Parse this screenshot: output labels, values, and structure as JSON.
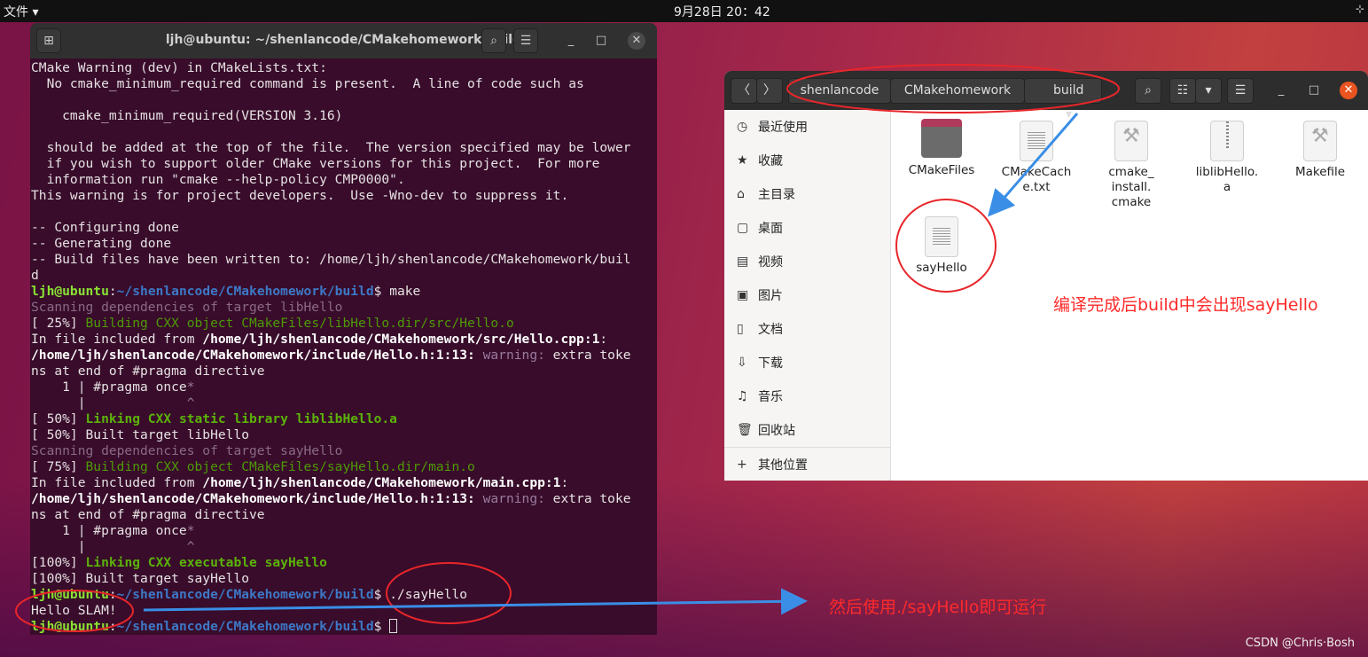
{
  "topbar": {
    "menu": "文件 ▾",
    "clock": "9月28日  20：42",
    "net_icon": "network-icon"
  },
  "terminal": {
    "title": "ljh@ubuntu: ~/shenlancode/CMakehomework/build",
    "lines": [
      [
        [
          "",
          "CMake Warning (dev) in CMakeLists.txt:"
        ]
      ],
      [
        [
          "",
          "  No cmake_minimum_required command is present.  A line of code such as"
        ]
      ],
      [],
      [
        [
          "",
          "    cmake_minimum_required(VERSION 3.16)"
        ]
      ],
      [],
      [
        [
          "",
          "  should be added at the top of the file.  The version specified may be lower"
        ]
      ],
      [
        [
          "",
          "  if you wish to support older CMake versions for this project.  For more"
        ]
      ],
      [
        [
          "",
          "  information run \"cmake --help-policy CMP0000\"."
        ]
      ],
      [
        [
          "",
          "This warning is for project developers.  Use -Wno-dev to suppress it."
        ]
      ],
      [],
      [
        [
          "",
          "-- Configuring done"
        ]
      ],
      [
        [
          "",
          "-- Generating done"
        ]
      ],
      [
        [
          "",
          "-- Build files have been written to: /home/ljh/shenlancode/CMakehomework/buil"
        ]
      ],
      [
        [
          "",
          "d"
        ]
      ],
      [
        [
          "user",
          "ljh@ubuntu"
        ],
        [
          "",
          ":"
        ],
        [
          "path",
          "~/shenlancode/CMakehomework/build"
        ],
        [
          "",
          "$ make"
        ]
      ],
      [
        [
          "dim",
          "Scanning dependencies of target libHello"
        ]
      ],
      [
        [
          "",
          "[ 25%] "
        ],
        [
          "green",
          "Building CXX object CMakeFiles/libHello.dir/src/Hello.o"
        ]
      ],
      [
        [
          "",
          "In file included from "
        ],
        [
          "bold",
          "/home/ljh/shenlancode/CMakehomework/src/Hello.cpp:1"
        ],
        [
          "",
          ":"
        ]
      ],
      [
        [
          "bold",
          "/home/ljh/shenlancode/CMakehomework/include/Hello.h:1:13:"
        ],
        [
          "warn",
          " warning:"
        ],
        [
          "",
          " extra toke"
        ]
      ],
      [
        [
          "",
          "ns at end of #pragma directive"
        ]
      ],
      [
        [
          "",
          "    1 | #pragma once"
        ],
        [
          "warn",
          "*"
        ]
      ],
      [
        [
          "",
          "      |             "
        ],
        [
          "warn",
          "^"
        ]
      ],
      [
        [
          "",
          "[ 50%] "
        ],
        [
          "bgreen",
          "Linking CXX static library liblibHello.a"
        ]
      ],
      [
        [
          "",
          "[ 50%] Built target libHello"
        ]
      ],
      [
        [
          "dim",
          "Scanning dependencies of target sayHello"
        ]
      ],
      [
        [
          "",
          "[ 75%] "
        ],
        [
          "green",
          "Building CXX object CMakeFiles/sayHello.dir/main.o"
        ]
      ],
      [
        [
          "",
          "In file included from "
        ],
        [
          "bold",
          "/home/ljh/shenlancode/CMakehomework/main.cpp:1"
        ],
        [
          "",
          ":"
        ]
      ],
      [
        [
          "bold",
          "/home/ljh/shenlancode/CMakehomework/include/Hello.h:1:13:"
        ],
        [
          "warn",
          " warning:"
        ],
        [
          "",
          " extra toke"
        ]
      ],
      [
        [
          "",
          "ns at end of #pragma directive"
        ]
      ],
      [
        [
          "",
          "    1 | #pragma once"
        ],
        [
          "warn",
          "*"
        ]
      ],
      [
        [
          "",
          "      |             "
        ],
        [
          "warn",
          "^"
        ]
      ],
      [
        [
          "",
          "[100%] "
        ],
        [
          "bgreen",
          "Linking CXX executable sayHello"
        ]
      ],
      [
        [
          "",
          "[100%] Built target sayHello"
        ]
      ],
      [
        [
          "user",
          "ljh@ubuntu"
        ],
        [
          "",
          ":"
        ],
        [
          "path",
          "~/shenlancode/CMakehomework/build"
        ],
        [
          "",
          "$ ./sayHello"
        ]
      ],
      [
        [
          "",
          "Hello SLAM!"
        ]
      ],
      [
        [
          "user",
          "ljh@ubuntu"
        ],
        [
          "",
          ":"
        ],
        [
          "path",
          "~/shenlancode/CMakehomework/build"
        ],
        [
          "",
          "$ "
        ],
        [
          "cursor",
          ""
        ]
      ]
    ]
  },
  "files": {
    "breadcrumb": [
      "shenlancode",
      "CMakehomework",
      "build"
    ],
    "sidebar": [
      {
        "icon": "clock-icon",
        "glyph": "◷",
        "label": "最近使用"
      },
      {
        "icon": "star-icon",
        "glyph": "★",
        "label": "收藏"
      },
      {
        "icon": "home-icon",
        "glyph": "⌂",
        "label": "主目录"
      },
      {
        "icon": "desktop-icon",
        "glyph": "▢",
        "label": "桌面"
      },
      {
        "icon": "video-icon",
        "glyph": "▤",
        "label": "视频"
      },
      {
        "icon": "image-icon",
        "glyph": "▣",
        "label": "图片"
      },
      {
        "icon": "document-icon",
        "glyph": "▯",
        "label": "文档"
      },
      {
        "icon": "download-icon",
        "glyph": "⇩",
        "label": "下载"
      },
      {
        "icon": "music-icon",
        "glyph": "♫",
        "label": "音乐"
      },
      {
        "icon": "trash-icon",
        "glyph": "🗑",
        "label": "回收站"
      },
      {
        "icon": "plus-icon",
        "glyph": "+",
        "label": "其他位置"
      }
    ],
    "items": [
      {
        "name": "CMakeFiles",
        "type": "folder"
      },
      {
        "name": "CMakeCache.txt",
        "type": "text"
      },
      {
        "name": "cmake_install.cmake",
        "type": "script"
      },
      {
        "name": "liblibHello.a",
        "type": "archive"
      },
      {
        "name": "Makefile",
        "type": "script"
      },
      {
        "name": "sayHello",
        "type": "text"
      }
    ]
  },
  "annotations": {
    "a1": "编译完成后build中会出现sayHello",
    "a2": "然后使用./sayHello即可运行",
    "color": "#ff2a2a",
    "arrow_color": "#3a8ee6"
  },
  "watermark": "CSDN @Chris·Bosh"
}
